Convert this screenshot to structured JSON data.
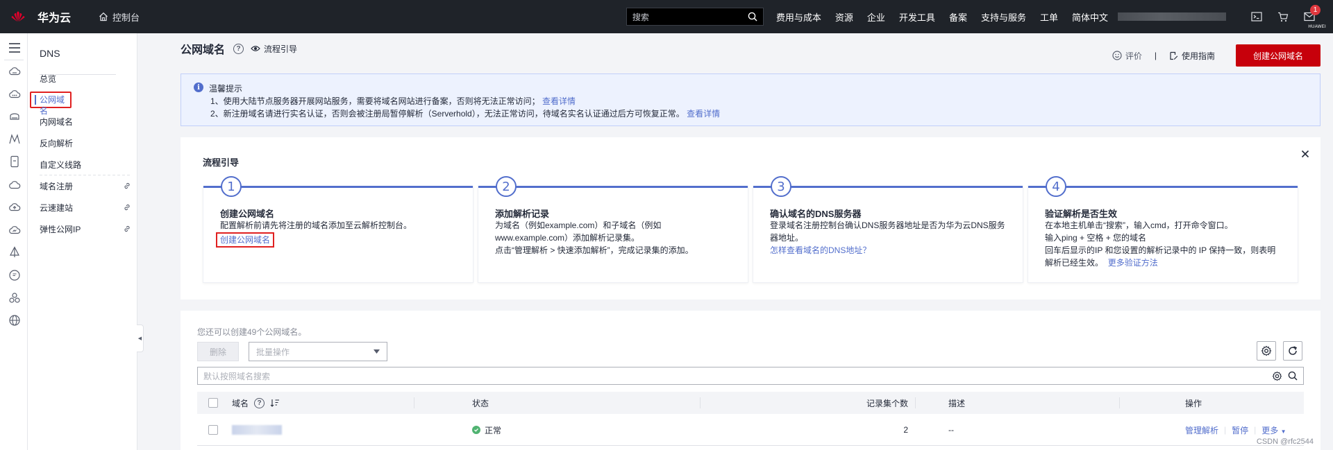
{
  "topbar": {
    "brand": "华为云",
    "logo_wordmark": "HUAWEI",
    "console": "控制台",
    "search_placeholder": "搜索",
    "nav": [
      "费用与成本",
      "资源",
      "企业",
      "开发工具",
      "备案",
      "支持与服务",
      "工单",
      "简体中文"
    ],
    "notification_count": "1"
  },
  "sidebar": {
    "title": "DNS",
    "items": [
      {
        "label": "总览",
        "active": false,
        "external": false
      },
      {
        "label": "公网域名",
        "active": true,
        "external": false
      },
      {
        "label": "内网域名",
        "active": false,
        "external": false
      },
      {
        "label": "反向解析",
        "active": false,
        "external": false
      },
      {
        "label": "自定义线路",
        "active": false,
        "external": false
      },
      {
        "label": "域名注册",
        "active": false,
        "external": true
      },
      {
        "label": "云速建站",
        "active": false,
        "external": true
      },
      {
        "label": "弹性公网IP",
        "active": false,
        "external": true
      }
    ]
  },
  "header": {
    "title": "公网域名",
    "guide": "流程引导",
    "rate": "评价",
    "manual": "使用指南",
    "create_button": "创建公网域名"
  },
  "notice": {
    "title": "温馨提示",
    "line1": "1、使用大陆节点服务器开展网站服务，需要将域名网站进行备案，否则将无法正常访问；",
    "line1_link": "查看详情",
    "line2": "2、新注册域名请进行实名认证，否则会被注册局暂停解析（Serverhold），无法正常访问，待域名实名认证通过后方可恢复正常。",
    "line2_link": "查看详情"
  },
  "flow": {
    "title": "流程引导",
    "steps": [
      {
        "num": "1",
        "title": "创建公网域名",
        "desc": "配置解析前请先将注册的域名添加至云解析控制台。",
        "link": "创建公网域名"
      },
      {
        "num": "2",
        "title": "添加解析记录",
        "desc1": "为域名（例如example.com）和子域名（例如",
        "desc2": "www.example.com）添加解析记录集。",
        "desc3": "点击“管理解析 > 快速添加解析”，完成记录集的添加。"
      },
      {
        "num": "3",
        "title": "确认域名的DNS服务器",
        "desc1": "登录域名注册控制台确认DNS服务器地址是否为华为云DNS服务",
        "desc2": "器地址。",
        "link": "怎样查看域名的DNS地址？"
      },
      {
        "num": "4",
        "title": "验证解析是否生效",
        "desc1": "在本地主机单击“搜索”，输入cmd，打开命令窗口。",
        "desc2": "输入ping + 空格 + 您的域名",
        "desc3": "回车后显示的IP 和您设置的解析记录中的 IP 保持一致，则表明",
        "desc4": "解析已经生效。",
        "link": "更多验证方法"
      }
    ]
  },
  "table": {
    "quota": "您还可以创建49个公网域名。",
    "delete_button": "删除",
    "batch_placeholder": "批量操作",
    "search_placeholder": "默认按照域名搜索",
    "columns": [
      "域名",
      "状态",
      "记录集个数",
      "描述",
      "操作"
    ],
    "rows": [
      {
        "status": "正常",
        "record_count": "2",
        "description": "--",
        "actions": [
          "管理解析",
          "暂停",
          "更多"
        ]
      }
    ]
  },
  "watermark": "CSDN @rfc2544",
  "colors": {
    "brand_red": "#c7000b",
    "link_blue": "#526ecc",
    "topbar_bg": "#1f2329",
    "annotation_red": "#e02020"
  }
}
